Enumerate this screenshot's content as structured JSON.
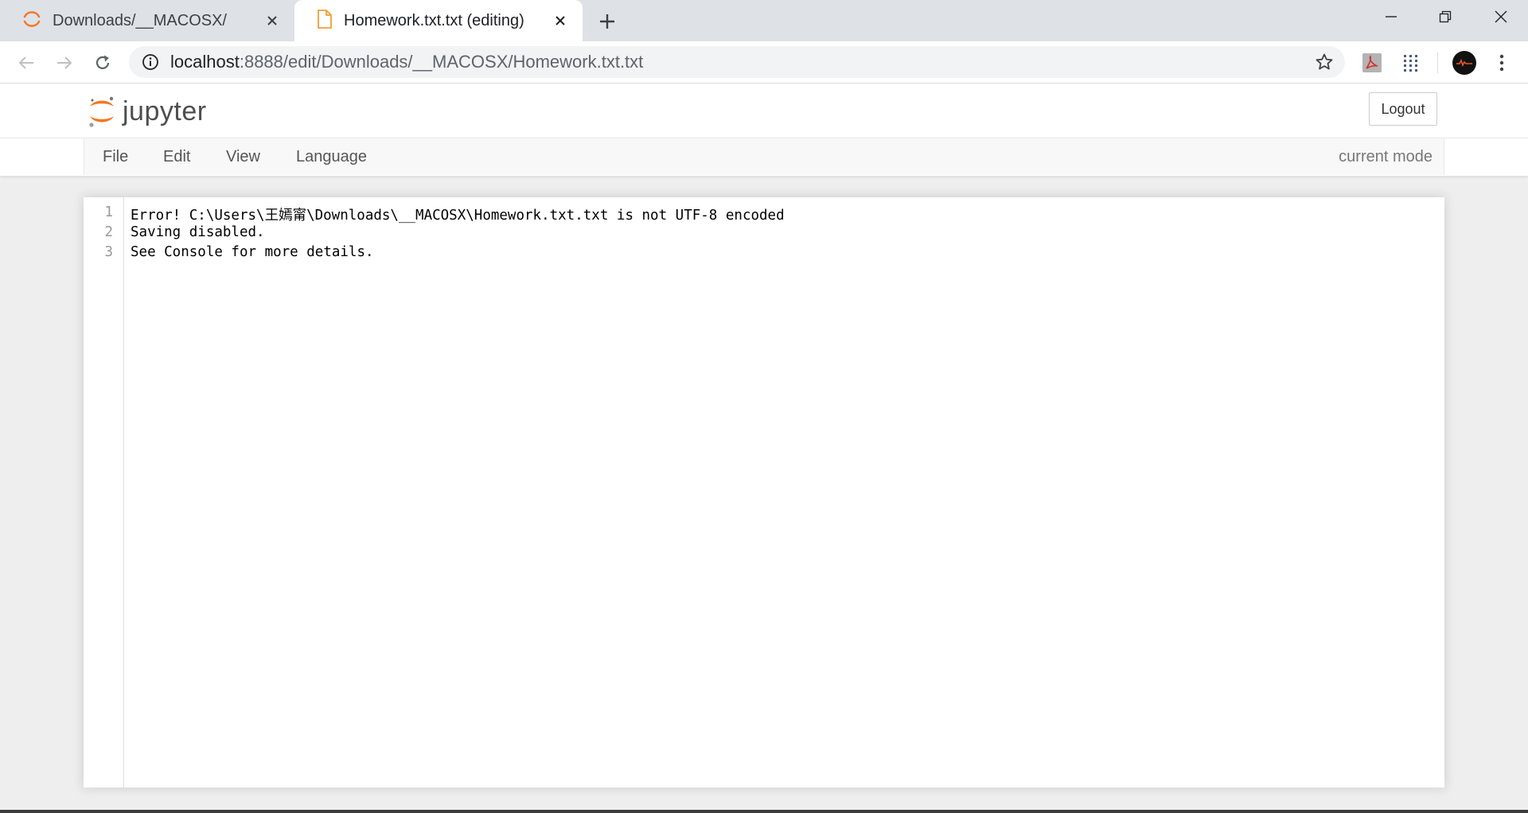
{
  "browser": {
    "tabs": [
      {
        "title": "Downloads/__MACOSX/",
        "icon": "jupyter-spinner-icon",
        "active": false
      },
      {
        "title": "Homework.txt.txt (editing)",
        "icon": "document-icon",
        "active": true
      }
    ],
    "address": {
      "host": "localhost",
      "path": ":8888/edit/Downloads/__MACOSX/Homework.txt.txt"
    },
    "extensions": [
      "pdf-extension-icon",
      "grid-extension-icon",
      "profile-avatar-icon"
    ]
  },
  "jupyter": {
    "logo_text": "jupyter",
    "logout_label": "Logout",
    "menu": [
      "File",
      "Edit",
      "View",
      "Language"
    ],
    "mode_label": "current mode",
    "editor_lines": [
      {
        "num": "1",
        "text": "Error! C:\\Users\\王嫣甯\\Downloads\\__MACOSX\\Homework.txt.txt is not UTF-8 encoded"
      },
      {
        "num": "2",
        "text": "Saving disabled."
      },
      {
        "num": "3",
        "text": "See Console for more details."
      }
    ]
  },
  "colors": {
    "jupyter_orange": "#f37726",
    "tab_strip": "#dee1e6",
    "page_background": "#eeeeee"
  }
}
